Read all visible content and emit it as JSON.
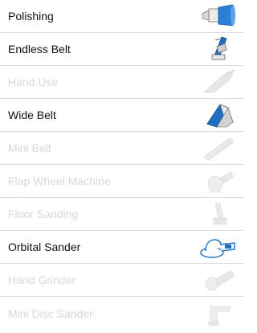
{
  "colors": {
    "active_text": "#111111",
    "inactive_text": "#d8d8d8",
    "brand_blue": "#1f6fc4",
    "icon_gray": "#bdbdbd",
    "divider": "#dcdcdc"
  },
  "items": [
    {
      "label": "Polishing",
      "active": true,
      "icon": "polishing-wheel-icon"
    },
    {
      "label": "Endless Belt",
      "active": true,
      "icon": "belt-tool-icon"
    },
    {
      "label": "Hand Use",
      "active": false,
      "icon": "hand-sanding-icon"
    },
    {
      "label": "Wide Belt",
      "active": true,
      "icon": "wide-belt-icon"
    },
    {
      "label": "Mini Belt",
      "active": false,
      "icon": "mini-belt-icon"
    },
    {
      "label": "Flap Wheel Machine",
      "active": false,
      "icon": "flap-wheel-icon"
    },
    {
      "label": "Floor Sanding",
      "active": false,
      "icon": "floor-sander-icon"
    },
    {
      "label": "Orbital Sander",
      "active": true,
      "icon": "orbital-sander-icon"
    },
    {
      "label": "Hand Grinder",
      "active": false,
      "icon": "hand-grinder-icon"
    },
    {
      "label": "Mini Disc Sander",
      "active": false,
      "icon": "mini-disc-sander-icon"
    }
  ]
}
